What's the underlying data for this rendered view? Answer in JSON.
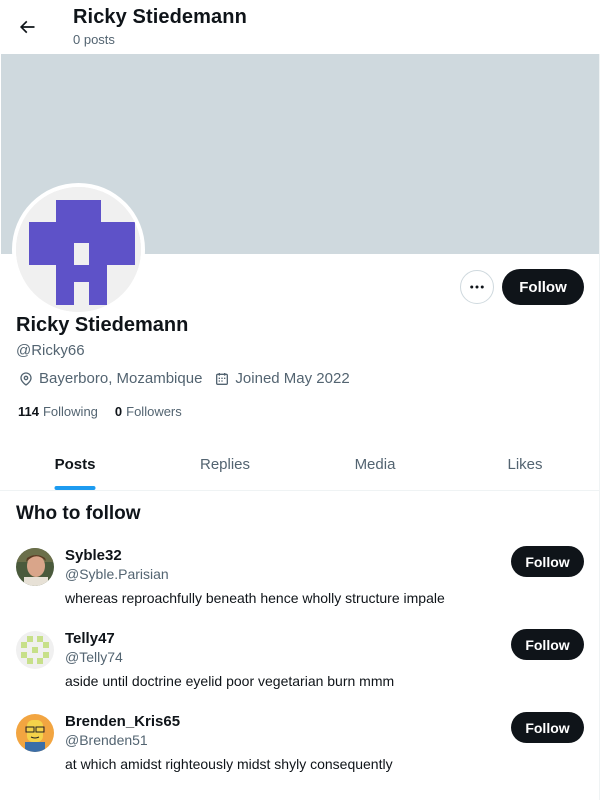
{
  "header": {
    "title": "Ricky Stiedemann",
    "subtitle": "0 posts"
  },
  "profile": {
    "name": "Ricky Stiedemann",
    "handle": "@Ricky66",
    "location": "Bayerboro, Mozambique",
    "joined": "Joined May 2022",
    "following_count": "114",
    "following_label": "Following",
    "followers_count": "0",
    "followers_label": "Followers",
    "follow_label": "Follow",
    "avatar_color": "#5e52c8",
    "banner_color": "#cfd9de"
  },
  "tabs": [
    {
      "label": "Posts",
      "active": true
    },
    {
      "label": "Replies",
      "active": false
    },
    {
      "label": "Media",
      "active": false
    },
    {
      "label": "Likes",
      "active": false
    }
  ],
  "who_to_follow": {
    "title": "Who to follow",
    "suggestions": [
      {
        "name": "Syble32",
        "handle": "@Syble.Parisian",
        "bio": "whereas reproachfully beneath hence wholly structure impale",
        "follow_label": "Follow",
        "avatar": "photo-avatar"
      },
      {
        "name": "Telly47",
        "handle": "@Telly74",
        "bio": "aside until doctrine eyelid poor vegetarian burn mmm",
        "follow_label": "Follow",
        "avatar": "identicon-avatar"
      },
      {
        "name": "Brenden_Kris65",
        "handle": "@Brenden51",
        "bio": "at which amidst righteously midst shyly consequently",
        "follow_label": "Follow",
        "avatar": "cartoon-avatar"
      }
    ]
  },
  "colors": {
    "accent": "#1d9bf0",
    "text_primary": "#0f1419",
    "text_secondary": "#536471"
  }
}
